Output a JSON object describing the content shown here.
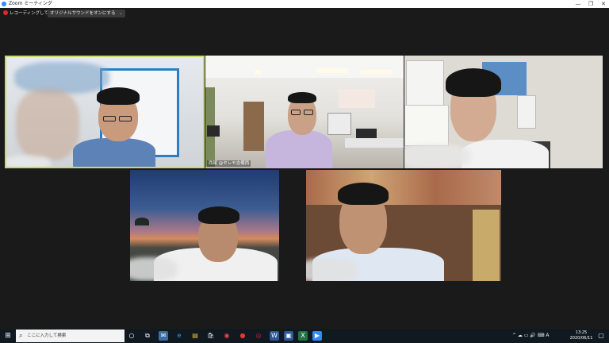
{
  "window": {
    "title": "Zoom ミーティング",
    "minimize_glyph": "—",
    "maximize_glyph": "❐",
    "close_glyph": "✕"
  },
  "meeting": {
    "recording_label": "レコーディングしています",
    "original_sound_label": "オリジナルサウンドをオンにする",
    "dropdown_glyph": "⌄"
  },
  "participants": [
    {
      "nametag": ""
    },
    {
      "nametag": "西尾 @セレモ吉備西"
    },
    {
      "nametag": ""
    },
    {
      "nametag": ""
    },
    {
      "nametag": ""
    }
  ],
  "taskbar": {
    "start_glyph": "⊞",
    "search_placeholder": "ここに入力して検索",
    "search_glyph": "⌕",
    "icons": [
      "○",
      "⧉",
      "✉",
      "e",
      "▤",
      "🛍",
      "◉",
      "●",
      "◎",
      "W",
      "▣",
      "X",
      "▶"
    ],
    "tray_text": "^ ☁ ▭ 🔊 ⌨ A",
    "time": "13:25",
    "date": "2020/06/11",
    "notification_glyph": "▢"
  },
  "colors": {
    "active_speaker_border": "#c8d86a",
    "recording": "#e02828",
    "zoom_blue": "#2d8cff",
    "taskbar_bg": "#101820"
  }
}
